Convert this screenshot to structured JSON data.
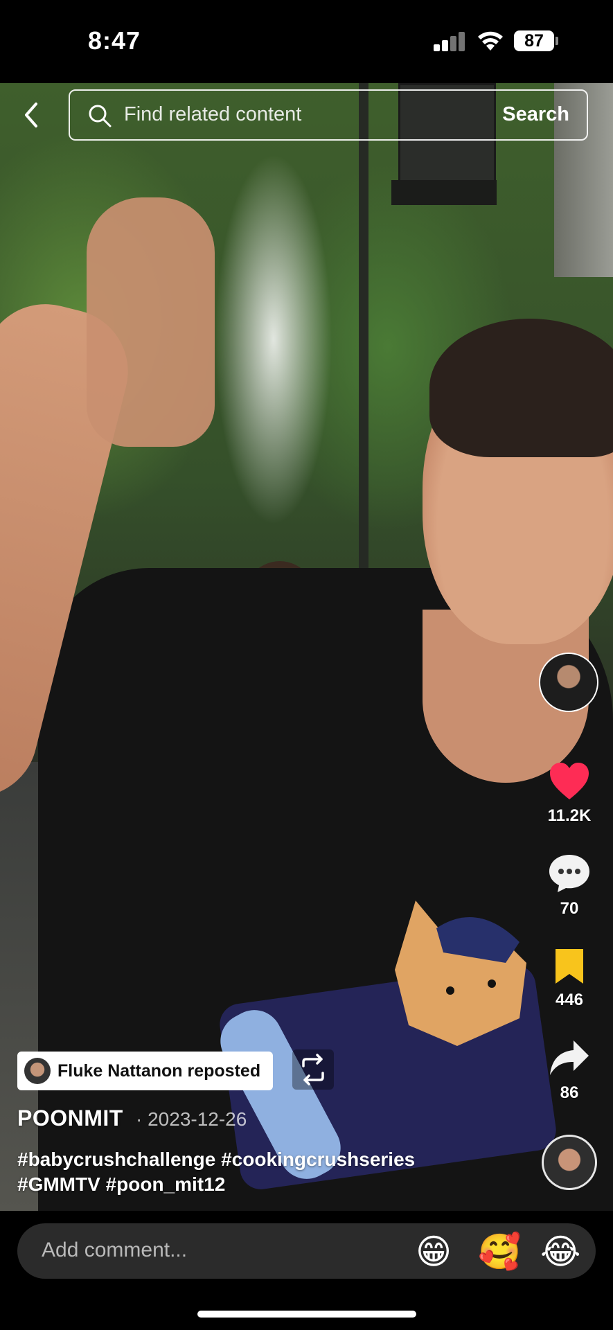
{
  "status_bar": {
    "time": "8:47",
    "battery": "87"
  },
  "search": {
    "placeholder": "Find related content",
    "button_label": "Search"
  },
  "actions": {
    "likes": "11.2K",
    "comments": "70",
    "saves": "446",
    "shares": "86"
  },
  "post": {
    "repost_label": "Fluke Nattanon reposted",
    "username": "POONMIT",
    "date": "· 2023-12-26",
    "caption_line1": "#babycrushchallenge #cookingcrushseries",
    "caption_line2": "#GMMTV #poon_mit12"
  },
  "comment_bar": {
    "placeholder": "Add comment...",
    "emojis": [
      "😁",
      "🥰",
      "😂"
    ]
  },
  "colors": {
    "like": "#fe2c55",
    "save": "#f8c41c",
    "accent": "#ffffff"
  }
}
